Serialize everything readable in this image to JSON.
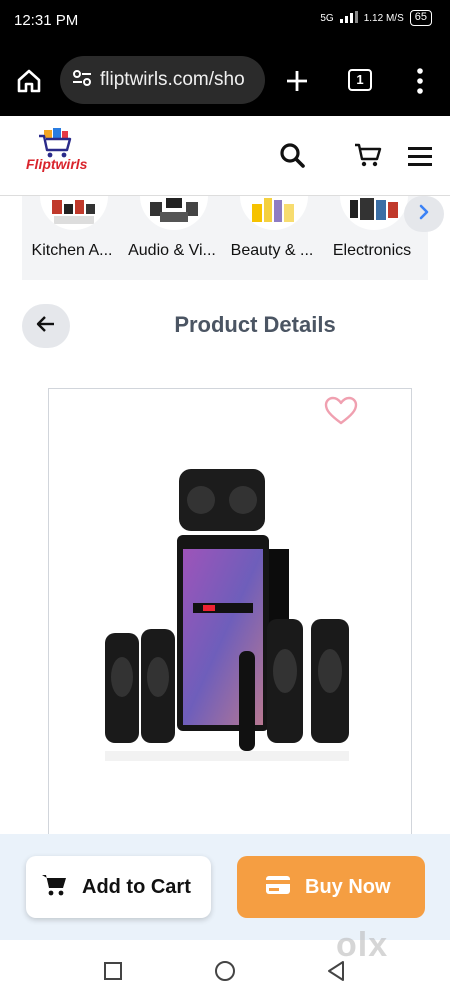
{
  "status_bar": {
    "time": "12:31 PM",
    "network": "5G",
    "speed": "1.12 M/S",
    "battery": "65"
  },
  "browser": {
    "url": "fliptwirls.com/sho",
    "tab_count": "1"
  },
  "site": {
    "logo_text": "Fliptwirls"
  },
  "categories": [
    {
      "label": "Kitchen A..."
    },
    {
      "label": "Audio & Vi..."
    },
    {
      "label": "Beauty & ..."
    },
    {
      "label": "Electronics"
    }
  ],
  "page": {
    "title": "Product Details"
  },
  "actions": {
    "add_to_cart": "Add to Cart",
    "buy_now": "Buy Now"
  },
  "watermark": "olx",
  "colors": {
    "accent_orange": "#f59e42",
    "action_bar_bg": "#eaf2fa",
    "heading_gray": "#4b5563",
    "chevron_blue": "#3b82f6",
    "heart_pink": "#f0a0b0"
  },
  "icons": {
    "home": "home-icon",
    "site_settings": "site-settings-icon",
    "new_tab": "plus-icon",
    "menu": "more-vert-icon",
    "search": "search-icon",
    "cart": "cart-icon",
    "hamburger": "hamburger-menu-icon",
    "next": "chevron-right-icon",
    "back": "arrow-left-icon",
    "favorite": "heart-icon",
    "add_cart": "cart-fill-icon",
    "buy": "card-icon"
  }
}
